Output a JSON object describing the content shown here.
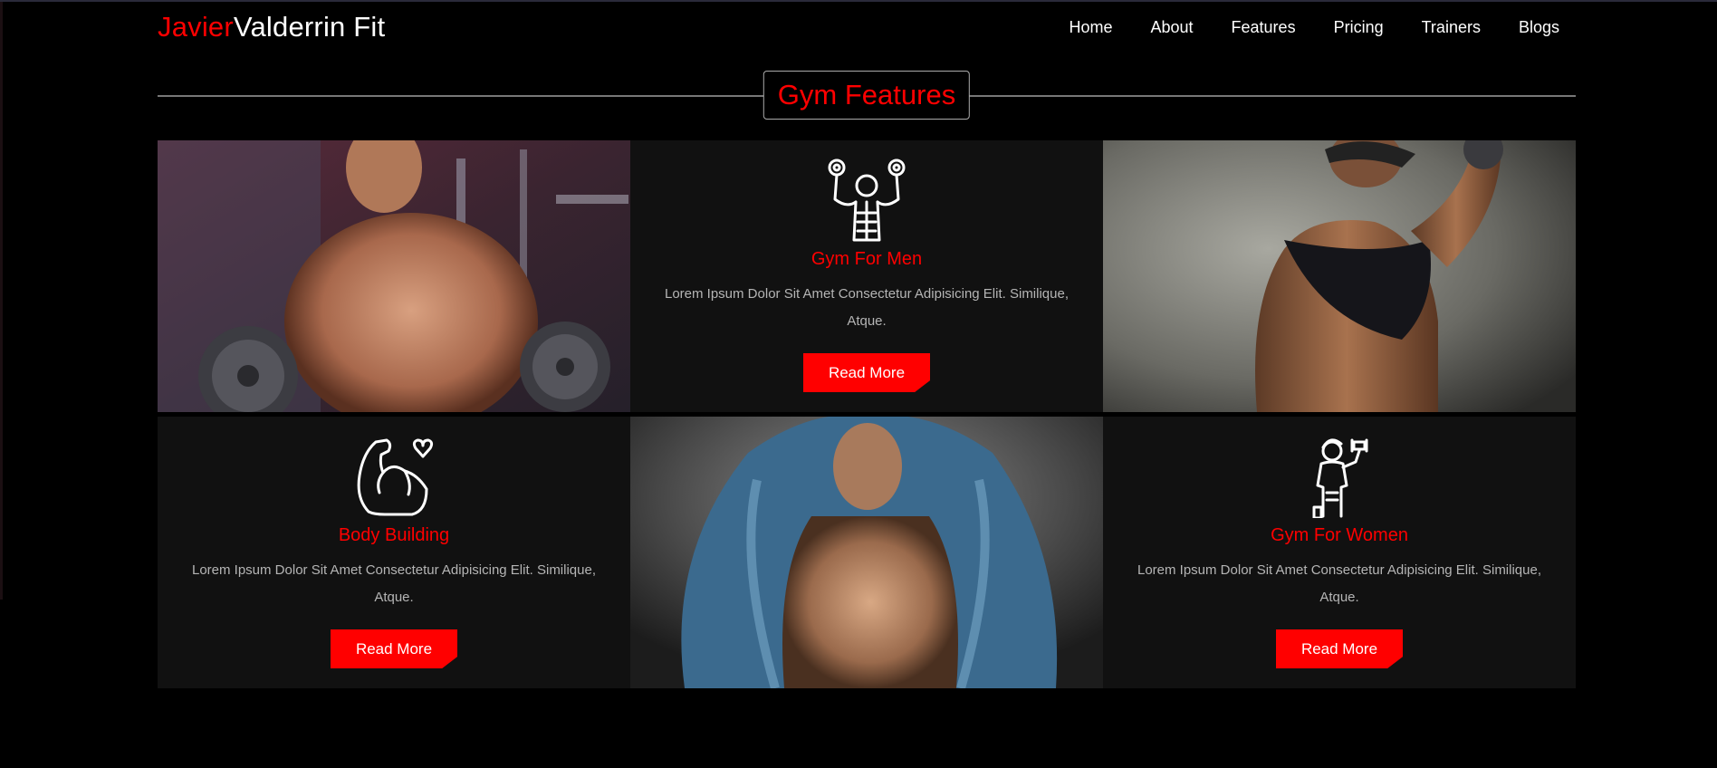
{
  "brand": {
    "accent": "Javier",
    "rest": "Valderrin Fit"
  },
  "nav": {
    "items": [
      "Home",
      "About",
      "Features",
      "Pricing",
      "Trainers",
      "Blogs"
    ]
  },
  "section": {
    "title": "Gym Features"
  },
  "features": [
    {
      "title": "Gym For Men",
      "description": "Lorem Ipsum Dolor Sit Amet Consectetur Adipisicing Elit. Similique, Atque.",
      "button": "Read More",
      "icon": "bodybuilder-dumbbells-icon"
    },
    {
      "title": "Body Building",
      "description": "Lorem Ipsum Dolor Sit Amet Consectetur Adipisicing Elit. Similique, Atque.",
      "button": "Read More",
      "icon": "flexed-arm-heart-icon"
    },
    {
      "title": "Gym For Women",
      "description": "Lorem Ipsum Dolor Sit Amet Consectetur Adipisicing Elit. Similique, Atque.",
      "button": "Read More",
      "icon": "woman-dumbbell-icon"
    }
  ],
  "colors": {
    "accent": "#ff0000",
    "background": "#000000",
    "card": "#111111",
    "text_muted": "#b5b5b5"
  }
}
